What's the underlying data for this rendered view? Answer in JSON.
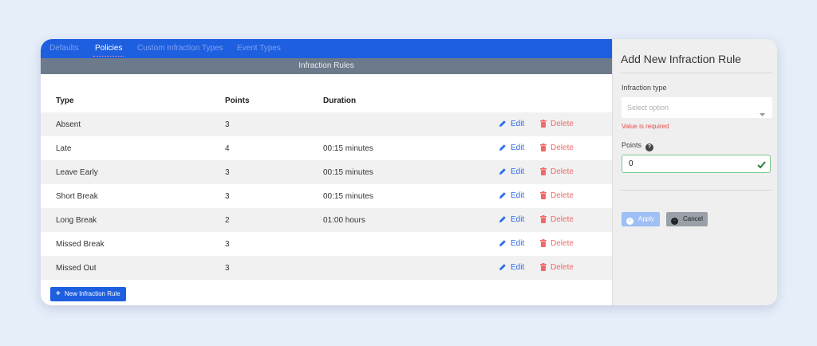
{
  "tabs": [
    {
      "label": "Defaults"
    },
    {
      "label": "Policies"
    },
    {
      "label": "Custom Infraction Types"
    },
    {
      "label": "Event Types"
    }
  ],
  "active_tab": "Policies",
  "section_title": "Infraction Rules",
  "table": {
    "headers": {
      "type": "Type",
      "points": "Points",
      "duration": "Duration"
    },
    "rows": [
      {
        "type": "Absent",
        "points": "3",
        "duration": "",
        "edit": "Edit",
        "delete": "Delete"
      },
      {
        "type": "Late",
        "points": "4",
        "duration": "00:15 minutes",
        "edit": "Edit",
        "delete": "Delete"
      },
      {
        "type": "Leave Early",
        "points": "3",
        "duration": "00:15 minutes",
        "edit": "Edit",
        "delete": "Delete"
      },
      {
        "type": "Short Break",
        "points": "3",
        "duration": "00:15 minutes",
        "edit": "Edit",
        "delete": "Delete"
      },
      {
        "type": "Long Break",
        "points": "2",
        "duration": "01:00 hours",
        "edit": "Edit",
        "delete": "Delete"
      },
      {
        "type": "Missed Break",
        "points": "3",
        "duration": "",
        "edit": "Edit",
        "delete": "Delete"
      },
      {
        "type": "Missed Out",
        "points": "3",
        "duration": "",
        "edit": "Edit",
        "delete": "Delete"
      }
    ]
  },
  "new_rule_button": "New Infraction Rule",
  "panel": {
    "title": "Add New Infraction Rule",
    "infraction_type_label": "Infraction type",
    "select_placeholder": "Select option",
    "error_text": "Value is required",
    "points_label": "Points",
    "points_value": "0",
    "apply_label": "Apply",
    "cancel_label": "Cancel"
  },
  "colors": {
    "primary": "#1e5fe0",
    "section_bar": "#6d7a8c",
    "edit": "#2f6be8",
    "delete": "#f06a6a",
    "error": "#e44b4b",
    "valid": "#7ac98a"
  },
  "icons": {
    "edit": "pencil-icon",
    "delete": "trash-icon",
    "help": "question-circle-icon",
    "valid": "check-icon",
    "caret": "chevron-down-icon"
  }
}
